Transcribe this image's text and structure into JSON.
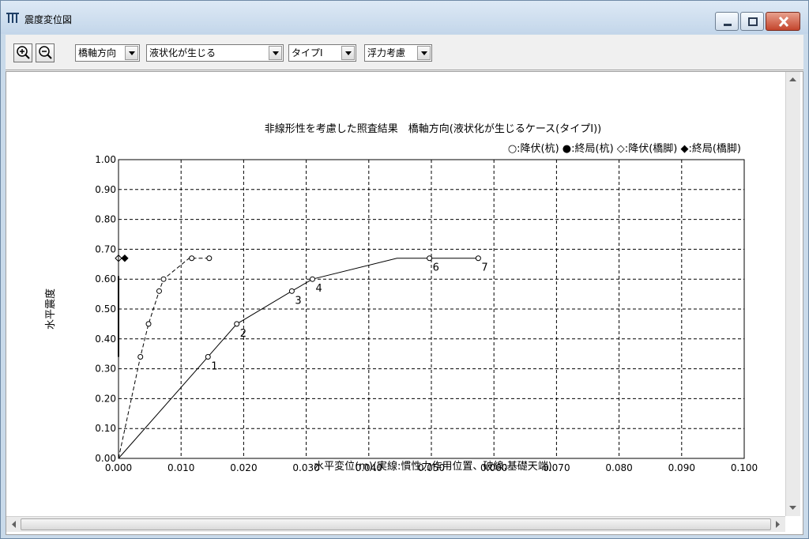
{
  "window": {
    "title": "震度変位図"
  },
  "toolbar": {
    "zoom_in_icon": "zoom-in-icon",
    "zoom_out_icon": "zoom-out-icon",
    "direction_value": "橋軸方向",
    "liquefaction_value": "液状化が生じる",
    "type_value": "タイプⅠ",
    "buoyancy_value": "浮力考慮"
  },
  "chart_data": {
    "type": "line",
    "title": "非線形性を考慮した照査結果　橋軸方向(液状化が生じるケース(タイプⅠ))",
    "legend": "○:降伏(杭) ●:終局(杭) ◇:降伏(橋脚) ◆:終局(橋脚)",
    "legend_placement": "top-right",
    "xlabel": "水平変位(m)(実線:慣性力作用位置、破線:基礎天端)",
    "ylabel": "水平震度",
    "xlim": [
      0,
      0.1
    ],
    "ylim": [
      0,
      1.0
    ],
    "x_ticks": [
      "0.000",
      "0.010",
      "0.020",
      "0.030",
      "0.040",
      "0.050",
      "0.060",
      "0.070",
      "0.080",
      "0.090",
      "0.100"
    ],
    "y_ticks": [
      "0.00",
      "0.10",
      "0.20",
      "0.30",
      "0.40",
      "0.50",
      "0.60",
      "0.70",
      "0.80",
      "0.90",
      "1.00"
    ],
    "grid": true,
    "series": [
      {
        "style": "solid",
        "points": [
          [
            0.0,
            0.0
          ],
          [
            0.0143,
            0.34
          ],
          [
            0.0189,
            0.45
          ],
          [
            0.0277,
            0.56
          ],
          [
            0.031,
            0.6
          ],
          [
            0.0445,
            0.67
          ],
          [
            0.0497,
            0.67
          ],
          [
            0.0575,
            0.67
          ]
        ],
        "markers": [
          {
            "x": 0.0143,
            "y": 0.34,
            "label": "1"
          },
          {
            "x": 0.0189,
            "y": 0.45,
            "label": "2"
          },
          {
            "x": 0.0277,
            "y": 0.56,
            "label": "3"
          },
          {
            "x": 0.031,
            "y": 0.6,
            "label": "4"
          },
          {
            "x": 0.0497,
            "y": 0.67,
            "label": "6"
          },
          {
            "x": 0.0575,
            "y": 0.67,
            "label": "7"
          }
        ]
      },
      {
        "style": "dashed",
        "points": [
          [
            0.0,
            0.0
          ],
          [
            0.0035,
            0.34
          ],
          [
            0.0048,
            0.45
          ],
          [
            0.0065,
            0.56
          ],
          [
            0.0072,
            0.6
          ],
          [
            0.0113,
            0.67
          ],
          [
            0.0145,
            0.67
          ]
        ],
        "markers": [
          [
            0.0035,
            0.34
          ],
          [
            0.0048,
            0.45
          ],
          [
            0.0065,
            0.56
          ],
          [
            0.0072,
            0.6
          ],
          [
            0.0117,
            0.67
          ],
          [
            0.0145,
            0.67
          ]
        ]
      }
    ],
    "pier_markers": [
      {
        "kind": "yield_pier",
        "x": 0.0,
        "y": 0.67
      },
      {
        "kind": "ultimate_pier",
        "x": 0.001,
        "y": 0.67
      }
    ]
  }
}
